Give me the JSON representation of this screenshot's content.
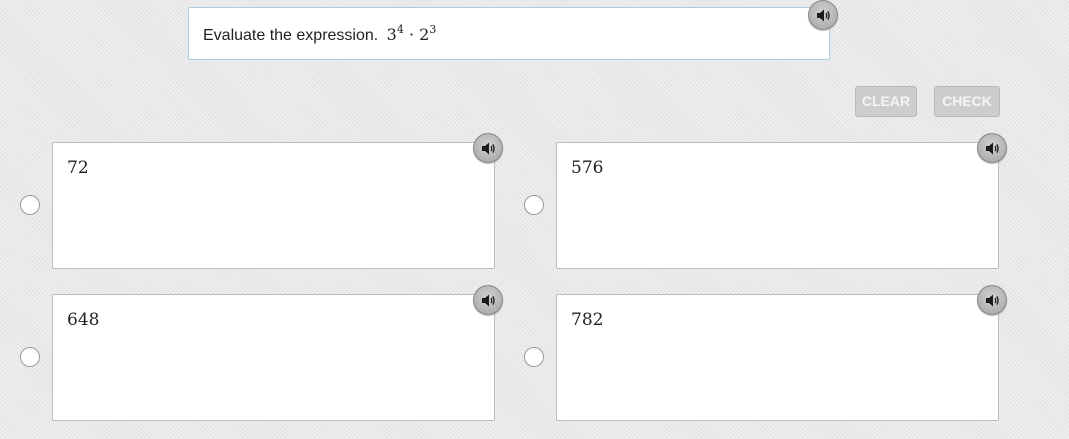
{
  "question": {
    "prefix": "Evaluate the expression.",
    "base1": "3",
    "exp1": "4",
    "operator": "·",
    "base2": "2",
    "exp2": "3",
    "audio_icon": "speaker-icon"
  },
  "actions": {
    "clear_label": "CLEAR",
    "check_label": "CHECK"
  },
  "choices": [
    {
      "value": "72",
      "selected": false
    },
    {
      "value": "576",
      "selected": false
    },
    {
      "value": "648",
      "selected": false
    },
    {
      "value": "782",
      "selected": false
    }
  ],
  "colors": {
    "question_border": "#a9cfe0",
    "disabled_button": "#cdcdcd",
    "background": "#e9e9e9"
  }
}
